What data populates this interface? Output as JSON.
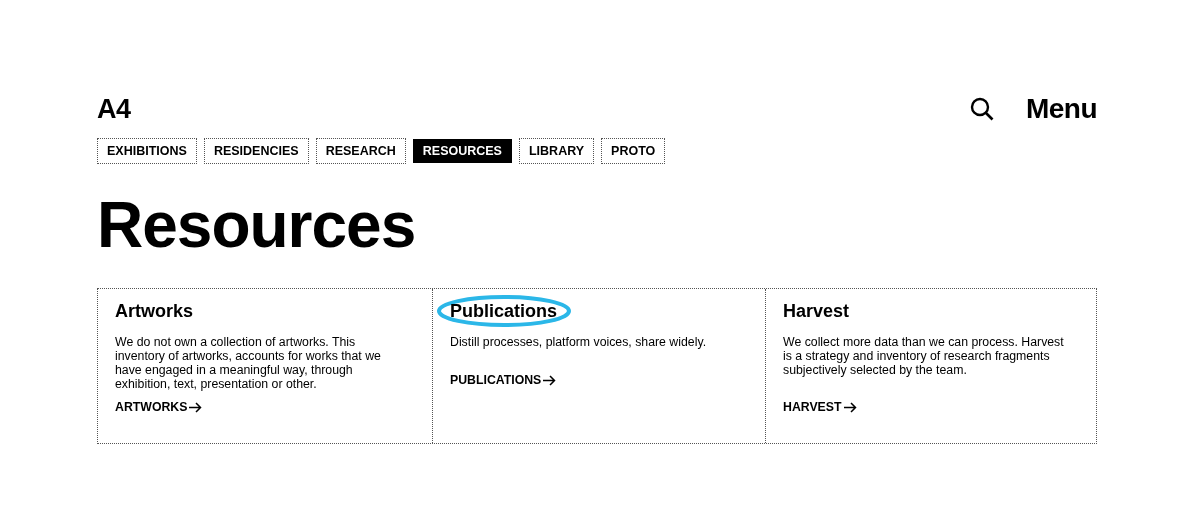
{
  "header": {
    "logo": "A4",
    "menu": "Menu"
  },
  "tabs": [
    {
      "label": "EXHIBITIONS",
      "selected": false
    },
    {
      "label": "RESIDENCIES",
      "selected": false
    },
    {
      "label": "RESEARCH",
      "selected": false
    },
    {
      "label": "RESOURCES",
      "selected": true
    },
    {
      "label": "LIBRARY",
      "selected": false
    },
    {
      "label": "PROTO",
      "selected": false
    }
  ],
  "page_title": "Resources",
  "cards": [
    {
      "title": "Artworks",
      "highlighted": false,
      "description": "We do not own a collection of artworks. This inventory of artworks, accounts for works that we have engaged in a meaningful way, through exhibition, text, presentation or other.",
      "link": "ARTWORKS"
    },
    {
      "title": "Publications",
      "highlighted": true,
      "description": "Distill processes, platform voices, share widely.",
      "link": "PUBLICATIONS"
    },
    {
      "title": "Harvest",
      "highlighted": false,
      "description": "We collect more data than we can process. Harvest is a strategy and inventory of research fragments subjectively selected by the team.",
      "link": "HARVEST"
    }
  ]
}
